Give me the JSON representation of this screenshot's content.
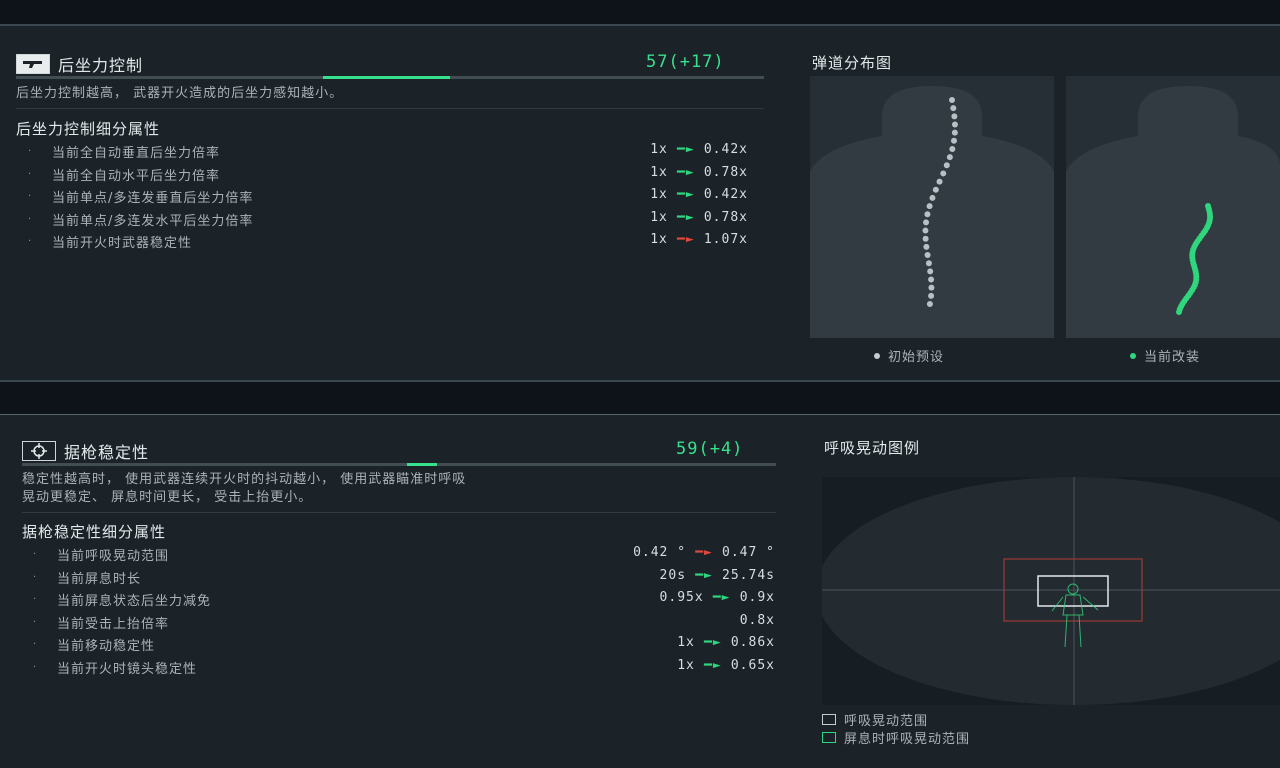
{
  "recoil": {
    "title": "后坐力控制",
    "score": "57(+17)",
    "progress_base_fraction": 0.58,
    "progress_bonus_fraction": 0.17,
    "description": "后坐力控制越高， 武器开火造成的后坐力感知越小。",
    "subtitle": "后坐力控制细分属性",
    "attributes": [
      {
        "name": "当前全自动垂直后坐力倍率",
        "from": "1x",
        "to": "0.42x",
        "trend": "good"
      },
      {
        "name": "当前全自动水平后坐力倍率",
        "from": "1x",
        "to": "0.78x",
        "trend": "good"
      },
      {
        "name": "当前单点/多连发垂直后坐力倍率",
        "from": "1x",
        "to": "0.42x",
        "trend": "good"
      },
      {
        "name": "当前单点/多连发水平后坐力倍率",
        "from": "1x",
        "to": "0.78x",
        "trend": "good"
      },
      {
        "name": "当前开火时武器稳定性",
        "from": "1x",
        "to": "1.07x",
        "trend": "bad"
      }
    ]
  },
  "ballistics": {
    "title": "弹道分布图",
    "legend_default": "初始预设",
    "legend_current": "当前改装"
  },
  "stability": {
    "title": "据枪稳定性",
    "score": "59(+4)",
    "progress_base_fraction": 0.55,
    "progress_bonus_fraction": 0.04,
    "description_line1": "稳定性越高时， 使用武器连续开火时的抖动越小， 使用武器瞄准时呼吸",
    "description_line2": "晃动更稳定、 屏息时间更长， 受击上抬更小。",
    "subtitle": "据枪稳定性细分属性",
    "attributes": [
      {
        "name": "当前呼吸晃动范围",
        "from": "0.42 °",
        "to": "0.47 °",
        "trend": "bad"
      },
      {
        "name": "当前屏息时长",
        "from": "20s",
        "to": "25.74s",
        "trend": "good"
      },
      {
        "name": "当前屏息状态后坐力减免",
        "from": "0.95x",
        "to": "0.9x",
        "trend": "good"
      },
      {
        "name": "当前受击上抬倍率",
        "from": "",
        "to": "0.8x",
        "trend": "none"
      },
      {
        "name": "当前移动稳定性",
        "from": "1x",
        "to": "0.86x",
        "trend": "good"
      },
      {
        "name": "当前开火时镜头稳定性",
        "from": "1x",
        "to": "0.65x",
        "trend": "good"
      }
    ]
  },
  "breathing": {
    "title": "呼吸晃动图例",
    "legend_range": "呼吸晃动范围",
    "legend_hold": "屏息时呼吸晃动范围"
  },
  "colors": {
    "accent_green": "#37e08a",
    "bad_red": "#e0483c",
    "good_green": "#2fd67e"
  }
}
